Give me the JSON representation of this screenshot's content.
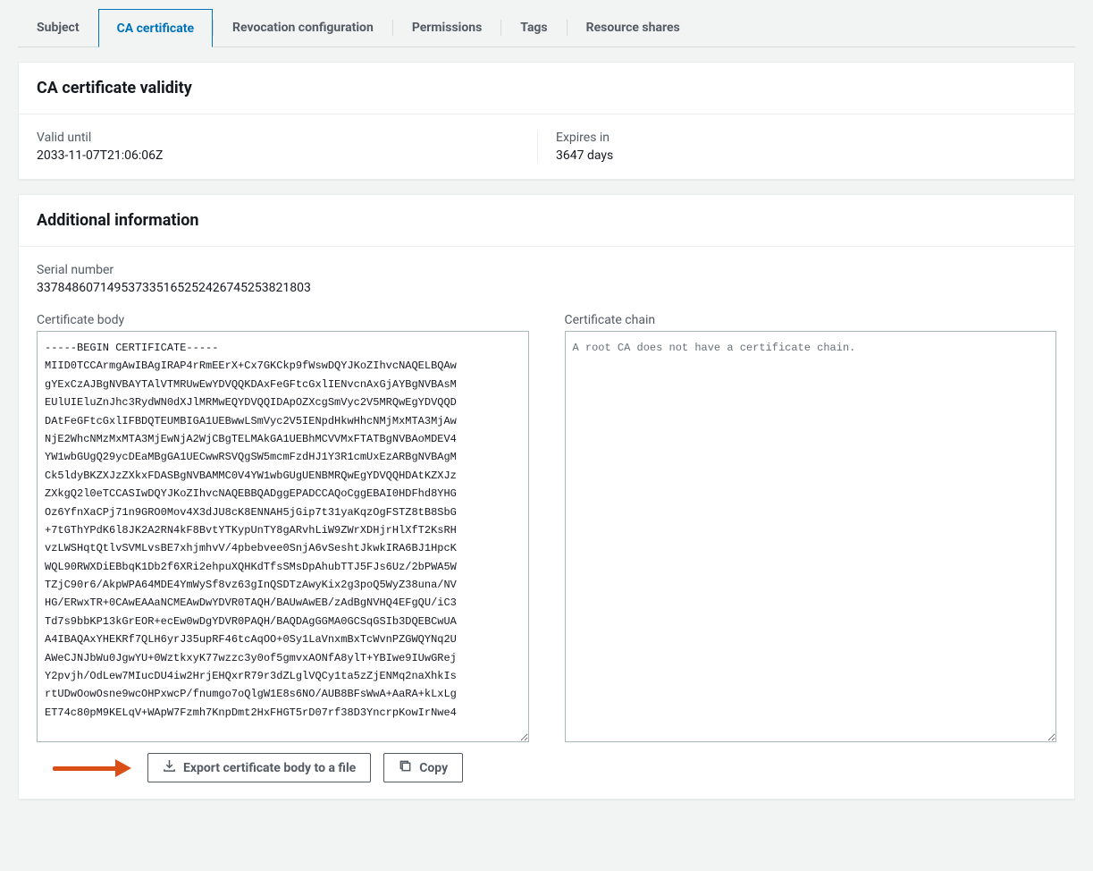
{
  "tabs": {
    "subject": "Subject",
    "ca_certificate": "CA certificate",
    "revocation": "Revocation configuration",
    "permissions": "Permissions",
    "tags": "Tags",
    "resource_shares": "Resource shares"
  },
  "validity": {
    "title": "CA certificate validity",
    "valid_until_label": "Valid until",
    "valid_until_value": "2033-11-07T21:06:06Z",
    "expires_in_label": "Expires in",
    "expires_in_value": "3647 days"
  },
  "additional": {
    "title": "Additional information",
    "serial_label": "Serial number",
    "serial_value": "337848607149537335165252426745253821803",
    "body_label": "Certificate body",
    "body_value": "-----BEGIN CERTIFICATE-----\nMIID0TCCArmgAwIBAgIRAP4rRmEErX+Cx7GKCkp9fWswDQYJKoZIhvcNAQELBQAw\ngYExCzAJBgNVBAYTAlVTMRUwEwYDVQQKDAxFeGFtcGxlIENvcnAxGjAYBgNVBAsM\nEUlUIEluZnJhc3RydWN0dXJlMRMwEQYDVQQIDApOZXcgSmVyc2V5MRQwEgYDVQQD\nDAtFeGFtcGxlIFBDQTEUMBIGA1UEBwwLSmVyc2V5IENpdHkwHhcNMjMxMTA3MjAw\nNjE2WhcNMzMxMTA3MjEwNjA2WjCBgTELMAkGA1UEBhMCVVMxFTATBgNVBAoMDEV4\nYW1wbGUgQ29ycDEaMBgGA1UECwwRSVQgSW5mcmFzdHJ1Y3R1cmUxEzARBgNVBAgM\nCk5ldyBKZXJzZXkxFDASBgNVBAMMC0V4YW1wbGUgUENBMRQwEgYDVQQHDAtKZXJz\nZXkgQ2l0eTCCASIwDQYJKoZIhvcNAQEBBQADggEPADCCAQoCggEBAI0HDFhd8YHG\nOz6YfnXaCPj71n9GRO0Mov4X3dJU8cK8ENNAH5jGip7t31yaKqzOgFSTZ8tB8SbG\n+7tGThYPdK6l8JK2A2RN4kF8BvtYTKypUnTY8gARvhLiW9ZWrXDHjrHlXfT2KsRH\nvzLWSHqtQtlvSVMLvsBE7xhjmhvV/4pbebvee0SnjA6vSeshtJkwkIRA6BJ1HpcK\nWQL90RWXDiEBbqK1Db2f6XRi2ehpuXQHKdTfsSMsDpAhubTTJ5FJs6Uz/2bPWA5W\nTZjC90r6/AkpWPA64MDE4YmWySf8vz63gInQSDTzAwyKix2g3poQ5WyZ38una/NV\nHG/ERwxTR+0CAwEAAaNCMEAwDwYDVR0TAQH/BAUwAwEB/zAdBgNVHQ4EFgQU/iC3\nTd7s9bbKP13kGrEOR+ecEw0wDgYDVR0PAQH/BAQDAgGGMA0GCSqGSIb3DQEBCwUA\nA4IBAQAxYHEKRf7QLH6yrJ35upRF46tcAqOO+0Sy1LaVnxmBxTcWvnPZGWQYNq2U\nAWeCJNJbWu0JgwYU+0WztkxyK77wzzc3y0of5gmvxAONfA8ylT+YBIwe9IUwGRej\nY2pvjh/OdLew7MIucDU4iw2HrjEHQxrR79r3dZLglVQCy1ta5zZjENMq2naXhkIs\nrtUDwOowOsne9wcOHPxwcP/fnumgo7oQlgW1E8s6NO/AUB8BFsWwA+AaRA+kLxLg\nET74c80pM9KELqV+WApW7Fzmh7KnpDmt2HxFHGT5rD07rf38D3YncrpKowIrNwe4",
    "chain_label": "Certificate chain",
    "chain_value": "A root CA does not have a certificate chain.",
    "export_label": "Export certificate body to a file",
    "copy_label": "Copy"
  }
}
